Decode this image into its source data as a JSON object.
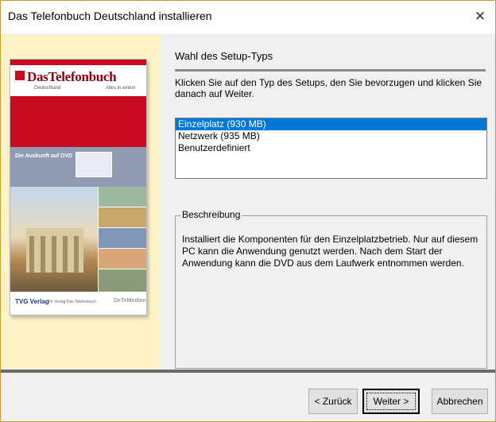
{
  "window": {
    "title": "Das Telefonbuch Deutschland installieren",
    "close_glyph": "✕"
  },
  "cover": {
    "brand": "DasTelefonbuch",
    "sub_left": "Deutschland",
    "sub_right": "Alles in einem",
    "dvd_tag": "Die Auskunft auf DVD",
    "publisher": "TVG Verlag",
    "publisher_sub": "Ihr Verlag Das Telefonbuch",
    "dvd_medien": "DeTeMedien"
  },
  "content": {
    "heading": "Wahl des Setup-Typs",
    "instruction": "Klicken Sie auf den Typ des Setups, den Sie bevorzugen und klicken Sie danach auf Weiter.",
    "options": [
      {
        "label": "Einzelplatz (930 MB)",
        "selected": true
      },
      {
        "label": "Netzwerk (935 MB)",
        "selected": false
      },
      {
        "label": "Benutzerdefiniert",
        "selected": false
      }
    ],
    "group_title": "Beschreibung",
    "description": "Installiert die Komponenten für den Einzelplatzbetrieb. Nur auf diesem PC kann die Anwendung genutzt werden. Nach dem Start der Anwendung kann die DVD aus dem Laufwerk entnommen werden."
  },
  "buttons": {
    "back": "< Zurück",
    "next": "Weiter >",
    "cancel": "Abbrechen"
  },
  "colors": {
    "selection": "#0078d7",
    "desktop": "#f7d98a",
    "brand_red": "#c80a1e"
  }
}
